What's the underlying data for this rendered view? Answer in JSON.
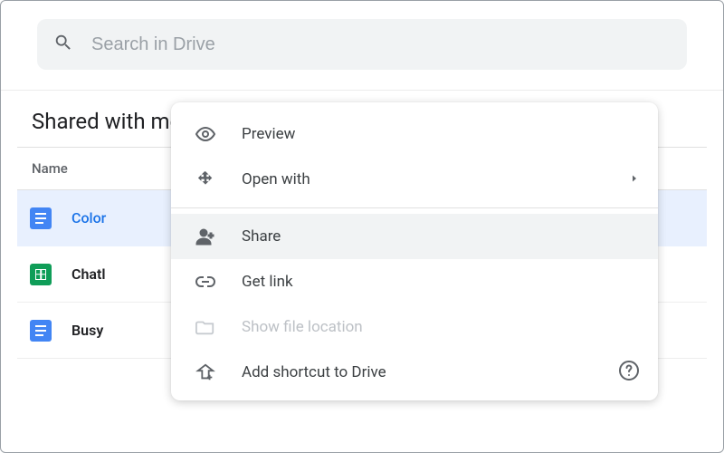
{
  "search": {
    "placeholder": "Search in Drive"
  },
  "heading": "Shared with me",
  "columns": {
    "name": "Name"
  },
  "files": [
    {
      "type": "docs",
      "label": "Color",
      "selected": true
    },
    {
      "type": "sheets",
      "label": "Chatl",
      "selected": false
    },
    {
      "type": "docs",
      "label": "Busy",
      "selected": false
    }
  ],
  "context_menu": {
    "items": [
      {
        "label": "Preview",
        "icon": "eye",
        "state": "normal",
        "submenu": false
      },
      {
        "label": "Open with",
        "icon": "move-arrows",
        "state": "normal",
        "submenu": true
      },
      {
        "separator": true
      },
      {
        "label": "Share",
        "icon": "person-add",
        "state": "hover",
        "submenu": false
      },
      {
        "label": "Get link",
        "icon": "link",
        "state": "normal",
        "submenu": false
      },
      {
        "label": "Show file location",
        "icon": "folder",
        "state": "disabled",
        "submenu": false
      },
      {
        "label": "Add shortcut to Drive",
        "icon": "shortcut",
        "state": "normal",
        "submenu": false,
        "help": true
      }
    ]
  }
}
